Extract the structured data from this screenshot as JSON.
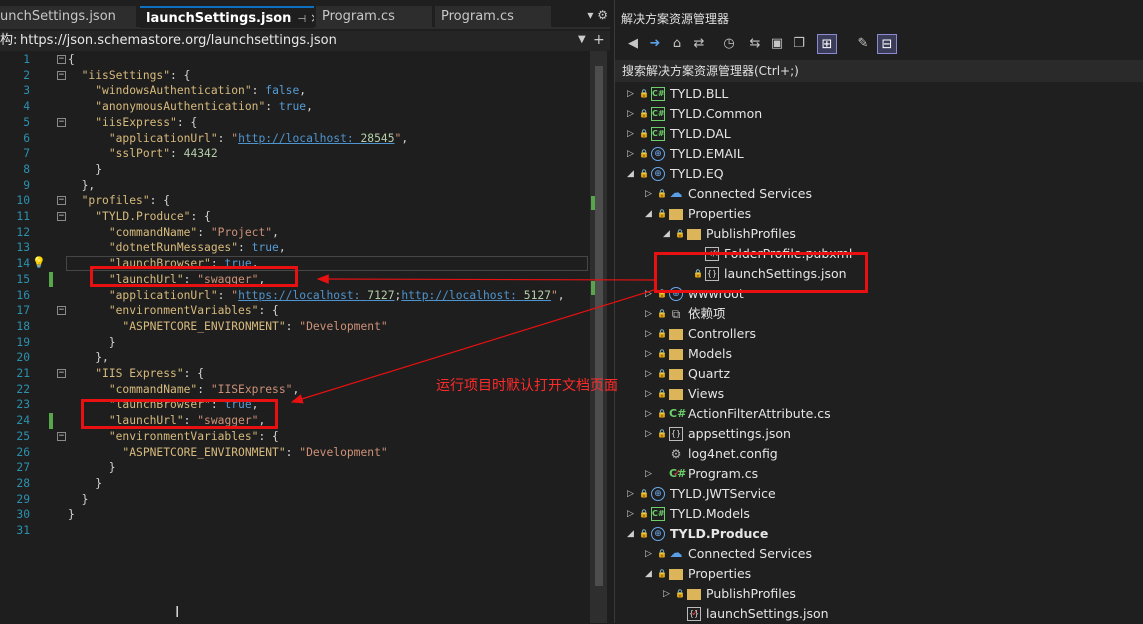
{
  "tabs": [
    {
      "label": "unchSettings.json",
      "active": false
    },
    {
      "label": "launchSettings.json",
      "active": true
    },
    {
      "label": "Program.cs",
      "active": false
    },
    {
      "label": "Program.cs",
      "active": false
    }
  ],
  "tab_pin": "⊣",
  "tab_close": "×",
  "tabbar_right": "▾ ⚙",
  "path_label": "构:",
  "schema_url": "https://json.schemastore.org/launchsettings.json",
  "code_lines": [
    {
      "n": "1",
      "t": "{"
    },
    {
      "n": "2",
      "t": "  \"iisSettings\": {"
    },
    {
      "n": "3",
      "t": "    \"windowsAuthentication\": false,"
    },
    {
      "n": "4",
      "t": "    \"anonymousAuthentication\": true,"
    },
    {
      "n": "5",
      "t": "    \"iisExpress\": {"
    },
    {
      "n": "6",
      "t": "      \"applicationUrl\": \"http://localhost:28545\","
    },
    {
      "n": "7",
      "t": "      \"sslPort\": 44342"
    },
    {
      "n": "8",
      "t": "    }"
    },
    {
      "n": "9",
      "t": "  },"
    },
    {
      "n": "10",
      "t": "  \"profiles\": {"
    },
    {
      "n": "11",
      "t": "    \"TYLD.Produce\": {"
    },
    {
      "n": "12",
      "t": "      \"commandName\": \"Project\","
    },
    {
      "n": "13",
      "t": "      \"dotnetRunMessages\": true,"
    },
    {
      "n": "14",
      "t": "      \"launchBrowser\": true,"
    },
    {
      "n": "15",
      "t": "      \"launchUrl\": \"swagger\","
    },
    {
      "n": "16",
      "t": "      \"applicationUrl\": \"https://localhost:7127;http://localhost:5127\","
    },
    {
      "n": "17",
      "t": "      \"environmentVariables\": {"
    },
    {
      "n": "18",
      "t": "        \"ASPNETCORE_ENVIRONMENT\": \"Development\""
    },
    {
      "n": "19",
      "t": "      }"
    },
    {
      "n": "20",
      "t": "    },"
    },
    {
      "n": "21",
      "t": "    \"IIS Express\": {"
    },
    {
      "n": "22",
      "t": "      \"commandName\": \"IISExpress\","
    },
    {
      "n": "23",
      "t": "      \"launchBrowser\": true,"
    },
    {
      "n": "24",
      "t": "      \"launchUrl\": \"swagger\","
    },
    {
      "n": "25",
      "t": "      \"environmentVariables\": {"
    },
    {
      "n": "26",
      "t": "        \"ASPNETCORE_ENVIRONMENT\": \"Development\""
    },
    {
      "n": "27",
      "t": "      }"
    },
    {
      "n": "28",
      "t": "    }"
    },
    {
      "n": "29",
      "t": "  }"
    },
    {
      "n": "30",
      "t": "}"
    },
    {
      "n": "31",
      "t": ""
    }
  ],
  "solution": {
    "title": "解决方案资源管理器",
    "search_label": "搜索解决方案资源管理器(Ctrl+;)",
    "tree": [
      {
        "label": "TYLD.BLL",
        "icon": "csproj-icon",
        "expanded": false
      },
      {
        "label": "TYLD.Common",
        "icon": "csproj-icon",
        "expanded": false
      },
      {
        "label": "TYLD.DAL",
        "icon": "csproj-icon",
        "expanded": false
      },
      {
        "label": "TYLD.EMAIL",
        "icon": "web-project-icon",
        "expanded": false
      },
      {
        "label": "TYLD.EQ",
        "icon": "web-project-icon",
        "expanded": true
      },
      {
        "label": "Connected Services",
        "icon": "connected-services-icon"
      },
      {
        "label": "Properties",
        "icon": "folder-icon",
        "expanded": true
      },
      {
        "label": "PublishProfiles",
        "icon": "folder-icon",
        "expanded": true
      },
      {
        "label": "FolderProfile.pubxml",
        "icon": "xml-file-icon"
      },
      {
        "label": "launchSettings.json",
        "icon": "json-file-icon"
      },
      {
        "label": "wwwroot",
        "icon": "web-folder-icon"
      },
      {
        "label": "依赖项",
        "icon": "dependencies-icon"
      },
      {
        "label": "Controllers",
        "icon": "folder-icon"
      },
      {
        "label": "Models",
        "icon": "folder-icon"
      },
      {
        "label": "Quartz",
        "icon": "folder-icon"
      },
      {
        "label": "Views",
        "icon": "folder-icon"
      },
      {
        "label": "ActionFilterAttribute.cs",
        "icon": "csharp-file-icon"
      },
      {
        "label": "appsettings.json",
        "icon": "json-file-icon"
      },
      {
        "label": "log4net.config",
        "icon": "config-file-icon"
      },
      {
        "label": "Program.cs",
        "icon": "csharp-file-icon"
      },
      {
        "label": "TYLD.JWTService",
        "icon": "web-project-icon",
        "expanded": false
      },
      {
        "label": "TYLD.Models",
        "icon": "csproj-icon",
        "expanded": false
      },
      {
        "label": "TYLD.Produce",
        "icon": "web-project-icon",
        "expanded": true,
        "bold": true
      },
      {
        "label": "Connected Services",
        "icon": "connected-services-icon"
      },
      {
        "label": "Properties",
        "icon": "folder-icon",
        "expanded": true
      },
      {
        "label": "PublishProfiles",
        "icon": "folder-icon"
      },
      {
        "label": "launchSettings.json",
        "icon": "json-file-icon"
      }
    ]
  },
  "annotation_text": "运行项目时默认打开文档页面",
  "colors": {
    "accent": "#0e70c0",
    "annotation": "#e81010",
    "string": "#ce9178",
    "key": "#d7ba7d",
    "keyword": "#569cd6"
  }
}
